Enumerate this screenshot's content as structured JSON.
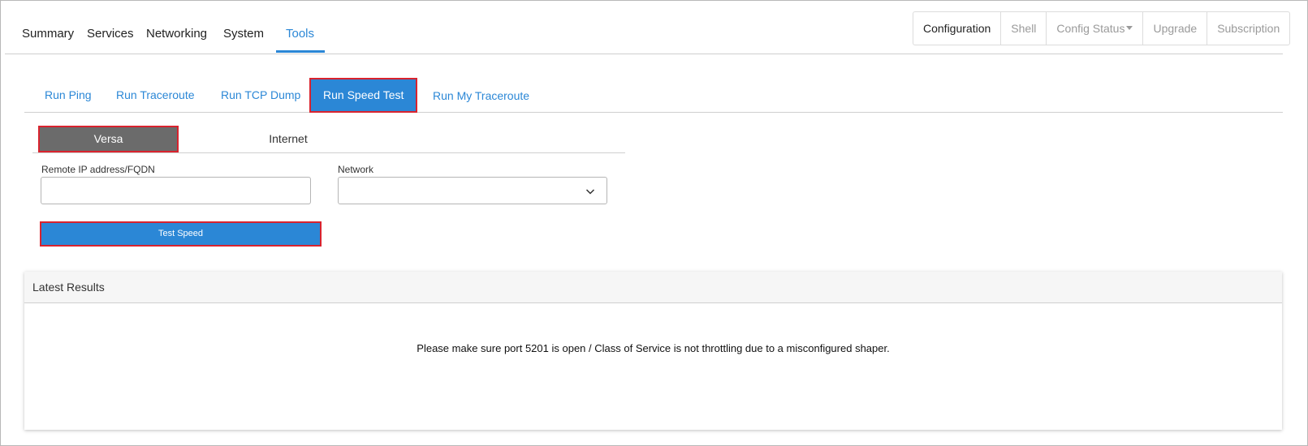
{
  "nav": {
    "items": [
      {
        "label": "Summary",
        "active": false
      },
      {
        "label": "Services",
        "active": false
      },
      {
        "label": "Networking",
        "active": false
      },
      {
        "label": "System",
        "active": false
      },
      {
        "label": "Tools",
        "active": true
      }
    ]
  },
  "actions": {
    "configuration": "Configuration",
    "shell": "Shell",
    "config_status": "Config Status",
    "upgrade": "Upgrade",
    "subscription": "Subscription"
  },
  "tool_tabs": {
    "items": [
      {
        "label": "Run Ping",
        "active": false
      },
      {
        "label": "Run Traceroute",
        "active": false
      },
      {
        "label": "Run TCP Dump",
        "active": false
      },
      {
        "label": "Run Speed Test",
        "active": true
      },
      {
        "label": "Run My Traceroute",
        "active": false
      }
    ]
  },
  "speed_mode": {
    "versa": "Versa",
    "internet": "Internet",
    "selected": "Versa"
  },
  "form": {
    "remote_label": "Remote IP address/FQDN",
    "remote_value": "",
    "network_label": "Network",
    "network_value": "",
    "submit_label": "Test Speed"
  },
  "results": {
    "title": "Latest Results",
    "message": "Please make sure port 5201 is open / Class of Service is not throttling due to a misconfigured shaper."
  },
  "colors": {
    "accent": "#2b87d6",
    "highlight_border": "#d9232e",
    "active_segment": "#6b6b6b"
  }
}
